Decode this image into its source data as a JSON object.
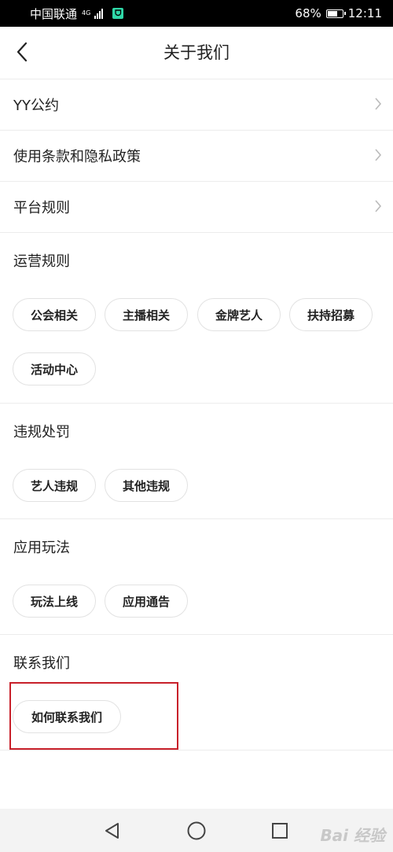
{
  "status_bar": {
    "carrier": "中国联通",
    "network": "4G",
    "battery": "68%",
    "battery_level": 0.68,
    "time": "12:11"
  },
  "header": {
    "title": "关于我们",
    "back_icon": "chevron-left-icon"
  },
  "menu_rows": [
    {
      "label": "YY公约"
    },
    {
      "label": "使用条款和隐私政策"
    },
    {
      "label": "平台规则"
    }
  ],
  "sections": [
    {
      "title": "运营规则",
      "chips": [
        "公会相关",
        "主播相关",
        "金牌艺人",
        "扶持招募",
        "活动中心"
      ]
    },
    {
      "title": "违规处罚",
      "chips": [
        "艺人违规",
        "其他违规"
      ]
    },
    {
      "title": "应用玩法",
      "chips": [
        "玩法上线",
        "应用通告"
      ]
    },
    {
      "title": "联系我们",
      "chips": [
        "如何联系我们"
      ]
    }
  ],
  "watermark": "Bai 经验",
  "colors": {
    "highlight": "#c8202a",
    "divider": "#ececec",
    "chip_border": "#e2e2e2"
  }
}
